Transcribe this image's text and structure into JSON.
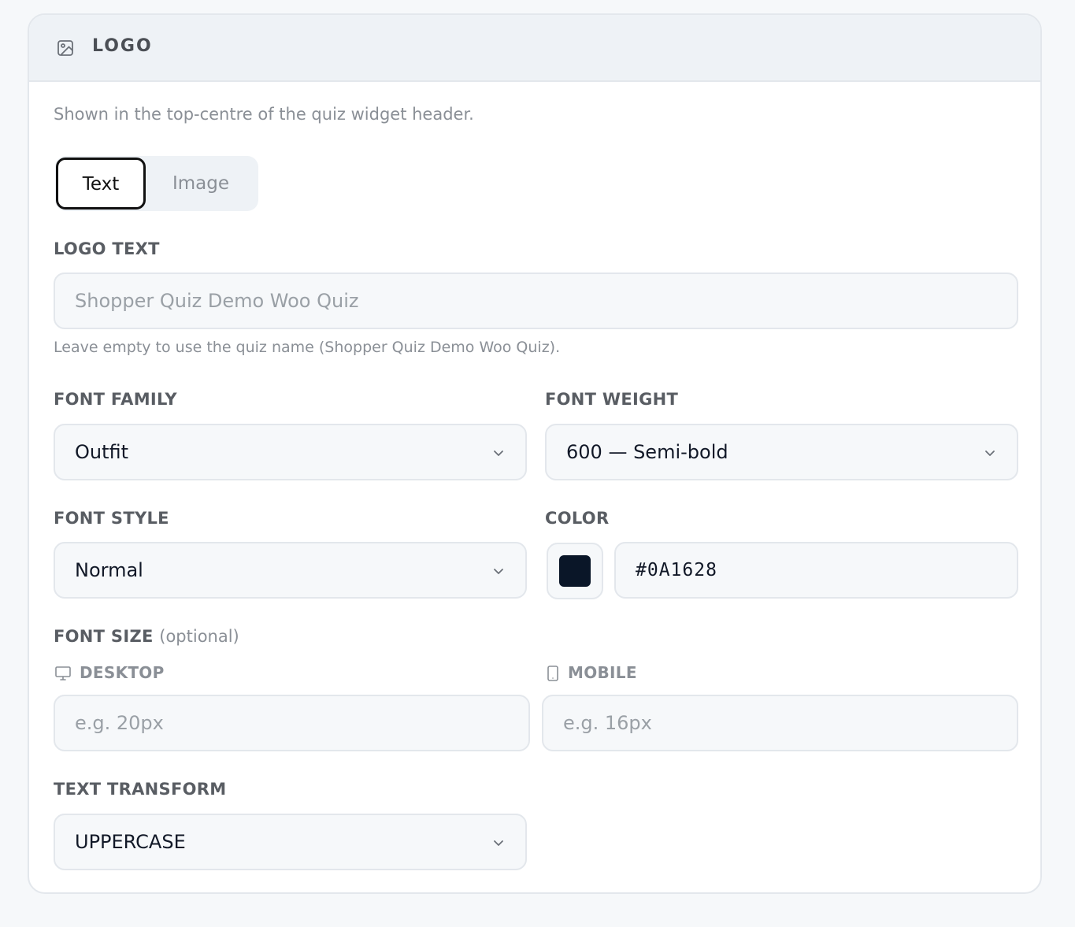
{
  "section": {
    "title": "LOGO",
    "icon": "image-icon",
    "description": "Shown in the top-centre of the quiz widget header."
  },
  "mode_toggle": {
    "options": [
      "Text",
      "Image"
    ],
    "selected": "Text"
  },
  "logo_text": {
    "label": "LOGO TEXT",
    "value": "",
    "placeholder": "Shopper Quiz Demo Woo Quiz",
    "help": "Leave empty to use the quiz name (Shopper Quiz Demo Woo Quiz)."
  },
  "font_family": {
    "label": "FONT FAMILY",
    "value": "Outfit"
  },
  "font_weight": {
    "label": "FONT WEIGHT",
    "value": "600 — Semi-bold"
  },
  "font_style": {
    "label": "FONT STYLE",
    "value": "Normal"
  },
  "color": {
    "label": "COLOR",
    "value": "#0A1628",
    "swatch": "#0A1628"
  },
  "font_size": {
    "label": "FONT SIZE",
    "optional": "(optional)",
    "desktop": {
      "label": "DESKTOP",
      "icon": "desktop-icon",
      "value": "",
      "placeholder": "e.g. 20px"
    },
    "mobile": {
      "label": "MOBILE",
      "icon": "mobile-icon",
      "value": "",
      "placeholder": "e.g. 16px"
    }
  },
  "text_transform": {
    "label": "TEXT TRANSFORM",
    "value": "UPPERCASE"
  }
}
